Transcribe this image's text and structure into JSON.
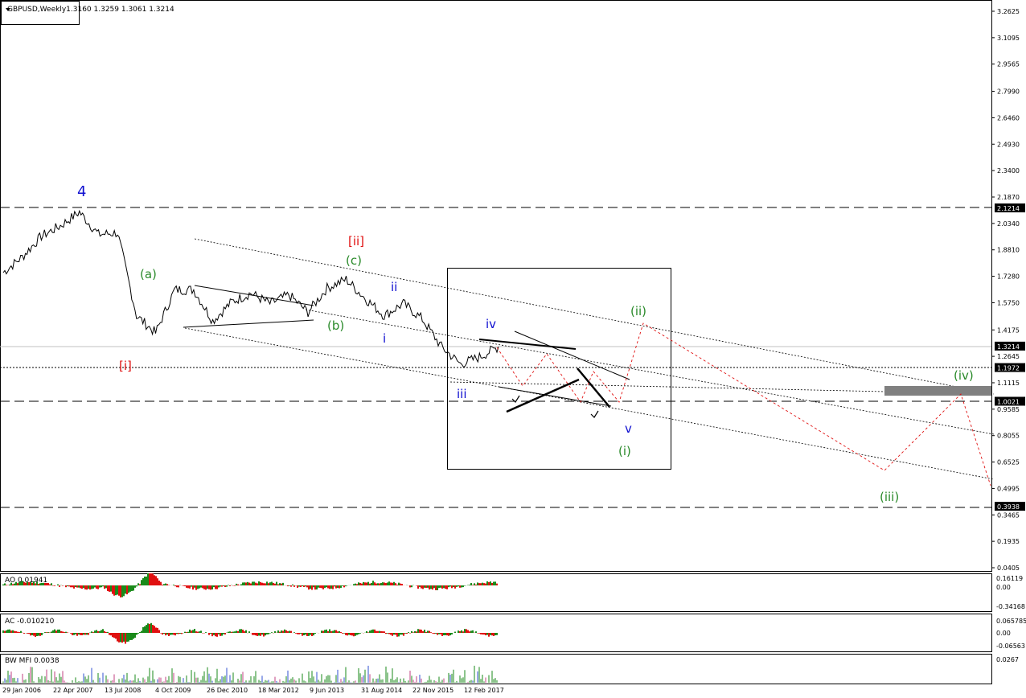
{
  "header": {
    "symbol": "GBPUSD,Weekly",
    "ohlc": "1.3160 1.3259 1.3061 1.3214"
  },
  "colors": {
    "price": "#000000",
    "wave_blue": "#1010d0",
    "wave_green": "#2a8a2a",
    "wave_red": "#e01010",
    "projection": "#e01010",
    "hist_up": "#1a8a1a",
    "hist_down": "#e01010",
    "mfi": "#1a8a1a",
    "tag_bg": "#000000",
    "tag_fg": "#ffffff",
    "zone": "#808080"
  },
  "axis": {
    "price_ticks": [
      "3.2625",
      "3.1095",
      "2.9565",
      "2.7990",
      "2.6460",
      "2.4930",
      "2.3400",
      "2.1870",
      "2.0340",
      "1.8810",
      "1.7280",
      "1.5750",
      "1.4175",
      "1.2645",
      "1.1115",
      "0.9585",
      "0.8055",
      "0.6525",
      "0.4995",
      "0.3465",
      "0.1935",
      "0.0405"
    ],
    "time_ticks": [
      "29 Jan 2006",
      "22 Apr 2007",
      "13 Jul 2008",
      "4 Oct 2009",
      "26 Dec 2010",
      "18 Mar 2012",
      "9 Jun 2013",
      "31 Aug 2014",
      "22 Nov 2015",
      "12 Feb 2017"
    ],
    "scale": "linear"
  },
  "price_tags": [
    {
      "value": "2.1214",
      "style": "long-dash"
    },
    {
      "value": "1.3214",
      "style": "current"
    },
    {
      "value": "1.1972",
      "style": "dotted"
    },
    {
      "value": "1.0021",
      "style": "long-dash"
    },
    {
      "value": "0.3938",
      "style": "long-dash"
    }
  ],
  "wave_labels": [
    {
      "text": "4",
      "color": "blue",
      "size": "large"
    },
    {
      "text": "[i]",
      "color": "red"
    },
    {
      "text": "[ii]",
      "color": "red"
    },
    {
      "text": "(a)",
      "color": "green"
    },
    {
      "text": "(b)",
      "color": "green"
    },
    {
      "text": "(c)",
      "color": "green"
    },
    {
      "text": "i",
      "color": "blue"
    },
    {
      "text": "ii",
      "color": "blue"
    },
    {
      "text": "iii",
      "color": "blue"
    },
    {
      "text": "iv",
      "color": "blue"
    },
    {
      "text": "v",
      "color": "blue"
    },
    {
      "text": "(i)",
      "color": "green"
    },
    {
      "text": "(ii)",
      "color": "green"
    },
    {
      "text": "(iii)",
      "color": "green"
    },
    {
      "text": "(iv)",
      "color": "green"
    }
  ],
  "indicators": {
    "ao": {
      "label": "AO 0.01941",
      "ticks": [
        "0.16119",
        "0.00",
        "-0.34168"
      ]
    },
    "ac": {
      "label": "AC -0.010210",
      "ticks": [
        "0.065785",
        "0.00",
        "-0.06563"
      ]
    },
    "mfi": {
      "label": "BW MFI 0.0038",
      "ticks": [
        "0.0267"
      ]
    }
  },
  "chart_data": {
    "type": "line",
    "title": "GBPUSD,Weekly",
    "ylim": [
      0.0405,
      3.2625
    ],
    "x": [
      "2006-01",
      "2006-06",
      "2007-01",
      "2007-07",
      "2007-11",
      "2008-03",
      "2008-07",
      "2008-11",
      "2009-01",
      "2009-06",
      "2009-10",
      "2010-05",
      "2010-12",
      "2011-06",
      "2012-03",
      "2012-09",
      "2013-06",
      "2014-01",
      "2014-07",
      "2014-10",
      "2015-03",
      "2015-07",
      "2015-11",
      "2016-06",
      "2016-10",
      "2017-02",
      "2017-03"
    ],
    "series": [
      {
        "values": [
          1.75,
          1.84,
          1.96,
          2.02,
          2.1,
          1.97,
          1.98,
          1.5,
          1.4,
          1.65,
          1.65,
          1.47,
          1.58,
          1.63,
          1.57,
          1.62,
          1.52,
          1.66,
          1.71,
          1.6,
          1.5,
          1.57,
          1.48,
          1.32,
          1.22,
          1.26,
          1.32
        ]
      }
    ],
    "ohlc_last": {
      "open": 1.316,
      "high": 1.3259,
      "low": 1.3061,
      "close": 1.3214
    }
  }
}
